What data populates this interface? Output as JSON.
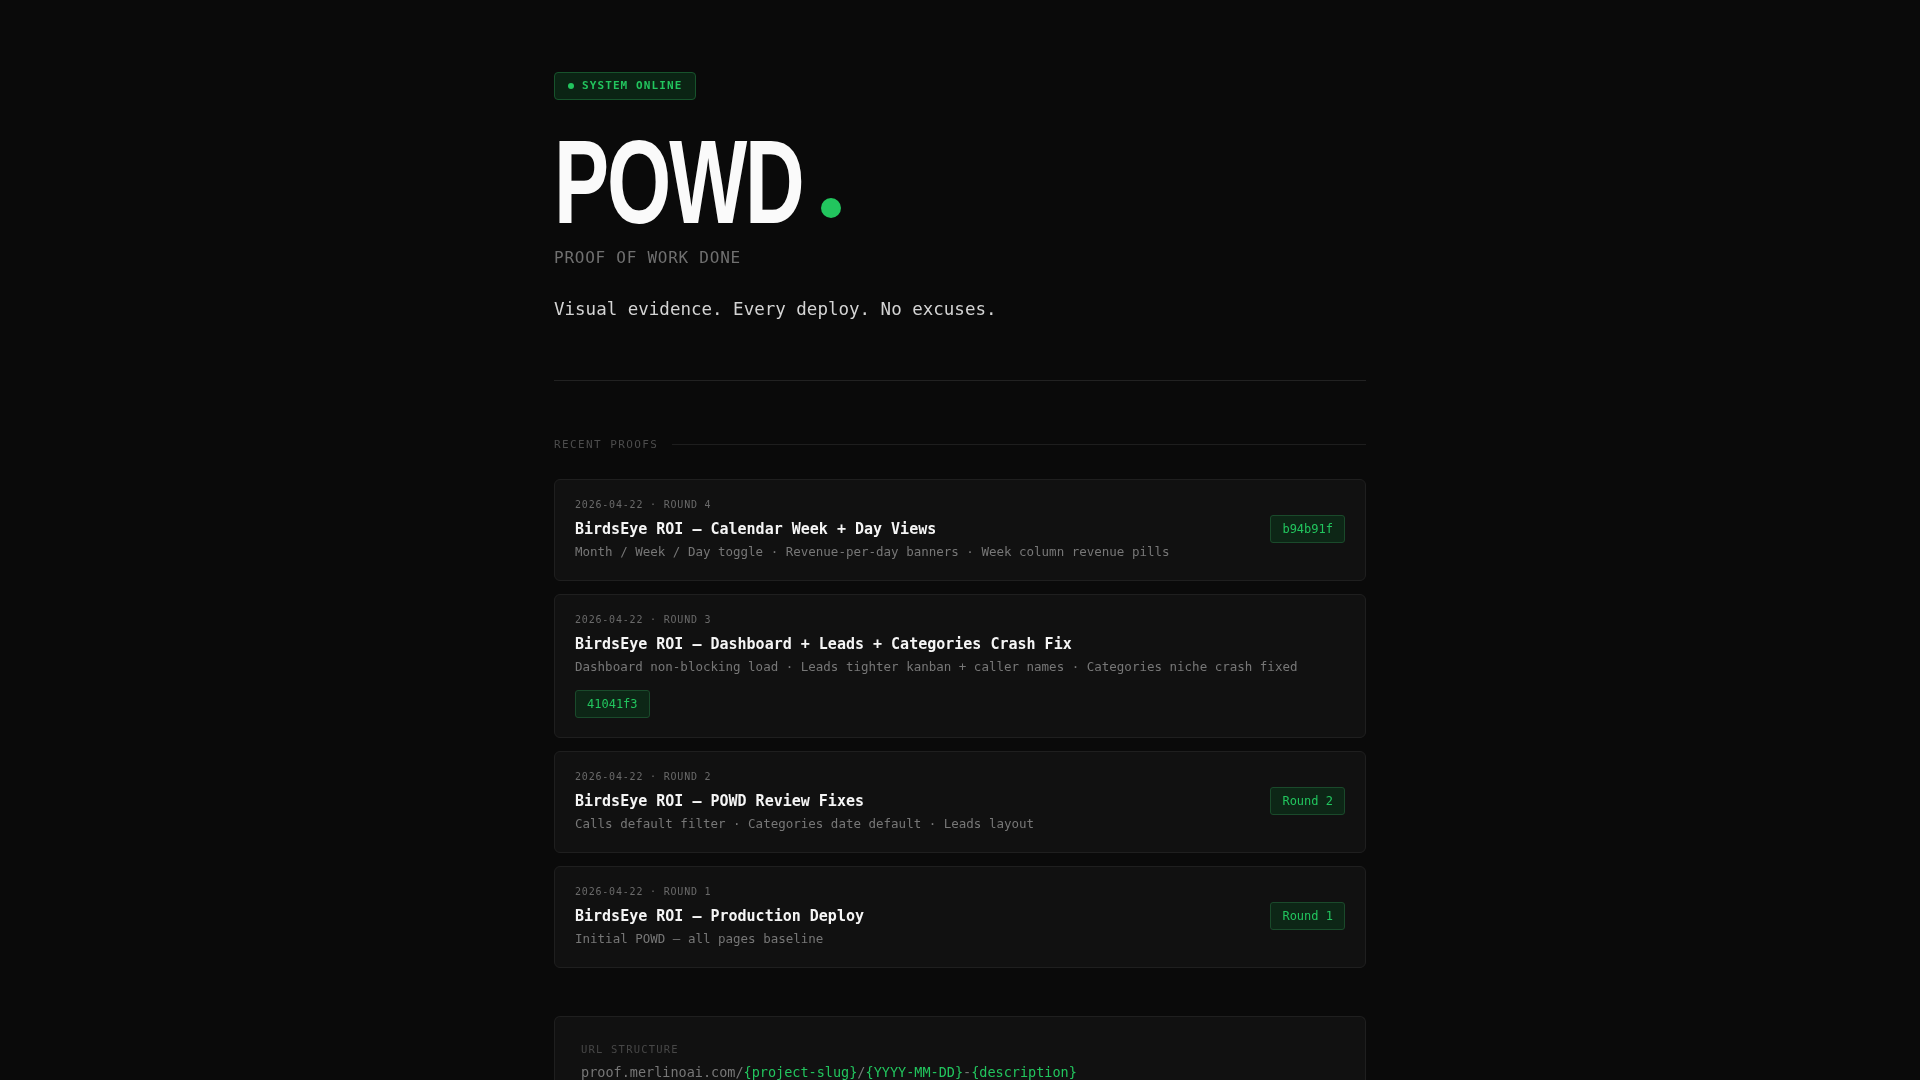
{
  "status_badge": {
    "label": "SYSTEM ONLINE"
  },
  "header": {
    "title": "POWD",
    "subtitle": "PROOF OF WORK DONE",
    "tagline": "Visual evidence. Every deploy. No excuses."
  },
  "recent_proofs": {
    "heading": "RECENT PROOFS",
    "items": [
      {
        "meta": "2026-04-22 · ROUND 4",
        "title": "BirdsEye ROI — Calendar Week + Day Views",
        "description": "Month / Week / Day toggle · Revenue-per-day banners · Week column revenue pills",
        "tag": "b94b91f"
      },
      {
        "meta": "2026-04-22 · ROUND 3",
        "title": "BirdsEye ROI — Dashboard + Leads + Categories Crash Fix",
        "description": "Dashboard non-blocking load · Leads tighter kanban + caller names · Categories niche crash fixed",
        "tag": "41041f3"
      },
      {
        "meta": "2026-04-22 · ROUND 2",
        "title": "BirdsEye ROI — POWD Review Fixes",
        "description": "Calls default filter · Categories date default · Leads layout",
        "tag": "Round 2"
      },
      {
        "meta": "2026-04-22 · ROUND 1",
        "title": "BirdsEye ROI — Production Deploy",
        "description": "Initial POWD — all pages baseline",
        "tag": "Round 1"
      }
    ]
  },
  "url_structure": {
    "label": "URL STRUCTURE",
    "parts": [
      {
        "text": "proof.merlinoai.com/",
        "kind": "static"
      },
      {
        "text": "{project-slug}",
        "kind": "variable"
      },
      {
        "text": "/",
        "kind": "static"
      },
      {
        "text": "{YYYY-MM-DD}",
        "kind": "variable"
      },
      {
        "text": "-",
        "kind": "static"
      },
      {
        "text": "{description}",
        "kind": "variable"
      }
    ]
  }
}
